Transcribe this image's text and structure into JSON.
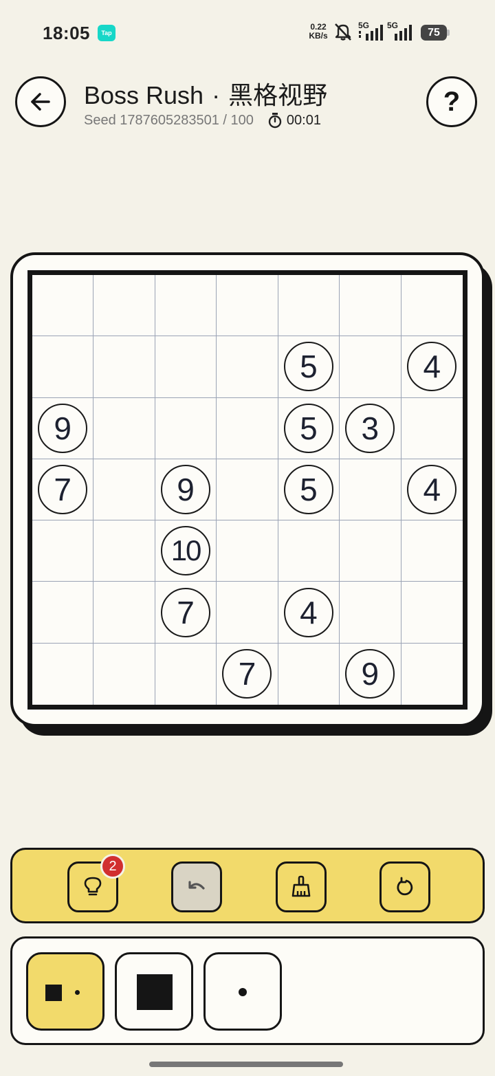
{
  "status_bar": {
    "time": "18:05",
    "app_icon": "Tap",
    "net_speed_value": "0.22",
    "net_speed_unit": "KB/s",
    "signal1_label": "5G",
    "signal2_label": "5G",
    "battery": "75"
  },
  "header": {
    "title_mode": "Boss Rush",
    "title_separator": "·",
    "title_name": "黑格视野",
    "seed": "Seed 1787605283501 / 100",
    "timer": "00:01",
    "help_label": "?"
  },
  "board": {
    "size": 7,
    "rows": [
      [
        "",
        "",
        "",
        "",
        "",
        "",
        ""
      ],
      [
        "",
        "",
        "",
        "",
        "5",
        "",
        "4"
      ],
      [
        "9",
        "",
        "",
        "",
        "5",
        "3",
        ""
      ],
      [
        "7",
        "",
        "9",
        "",
        "5",
        "",
        "4"
      ],
      [
        "",
        "",
        "10",
        "",
        "",
        "",
        ""
      ],
      [
        "",
        "",
        "7",
        "",
        "4",
        "",
        ""
      ],
      [
        "",
        "",
        "",
        "7",
        "",
        "9",
        ""
      ]
    ]
  },
  "toolbar": {
    "hint_count": "2",
    "buttons": [
      {
        "name": "hint-button",
        "icon": "lightbulb-icon"
      },
      {
        "name": "undo-button",
        "icon": "undo-icon"
      },
      {
        "name": "clear-button",
        "icon": "broom-icon"
      },
      {
        "name": "reset-button",
        "icon": "refresh-icon"
      }
    ]
  },
  "modes": [
    {
      "name": "mixed-mode",
      "icon": "square-dot-icon",
      "selected": true
    },
    {
      "name": "fill-mode",
      "icon": "filled-square-icon",
      "selected": false
    },
    {
      "name": "dot-mode",
      "icon": "dot-icon",
      "selected": false
    }
  ],
  "colors": {
    "background": "#f4f2e8",
    "accent_yellow": "#f2da6b",
    "badge_red": "#d12f2f",
    "ink": "#151515",
    "grid_line": "#9aa3b5"
  }
}
